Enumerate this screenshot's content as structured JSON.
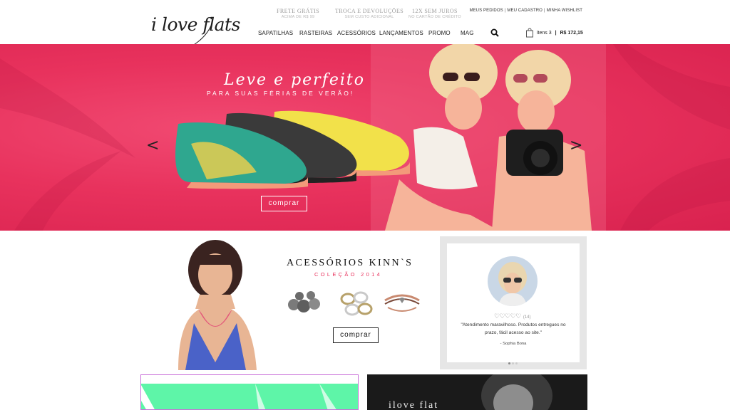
{
  "header": {
    "logo_text": "i love flats",
    "perks": [
      {
        "title": "FRETE GRÁTIS",
        "subtitle": "ACIMA DE R$ 99"
      },
      {
        "title": "TROCA E DEVOLUÇÕES",
        "subtitle": "SEM CUSTO ADICIONAL"
      },
      {
        "title": "12X SEM JUROS",
        "subtitle": "NO CARTÃO DE CRÉDITO"
      }
    ],
    "account_links": [
      "MEUS PEDIDOS",
      "MEU CADASTRO",
      "MINHA WISHLIST"
    ],
    "nav": [
      "SAPATILHAS",
      "RASTEIRAS",
      "ACESSÓRIOS",
      "LANÇAMENTOS",
      "PROMO",
      "MAG"
    ],
    "cart": {
      "items_label": "itens 3",
      "separator": "|",
      "total": "R$ 172,15"
    }
  },
  "hero": {
    "title": "Leve e perfeito",
    "subtitle": "PARA SUAS FÉRIAS DE VERÃO!",
    "button_label": "comprar",
    "prev_arrow": "<",
    "next_arrow": ">",
    "colors": {
      "background": "#e8325d"
    }
  },
  "accessories": {
    "title": "ACESSÓRIOS KINN`S",
    "subtitle": "COLEÇÃO 2014",
    "button_label": "comprar",
    "colors": {
      "accent": "#e8325d"
    }
  },
  "testimonial": {
    "rating_hearts": "♡♡♡♡♡",
    "rating_count": "(14)",
    "quote": "\"Atendimento maravilhoso. Produtos entregues no prazo, fácil acesso ao site.\"",
    "author": "- Sophia Bona",
    "dots": 3,
    "active_dot": 1
  },
  "bottom": {
    "right_banner_text": "ilove flat"
  }
}
